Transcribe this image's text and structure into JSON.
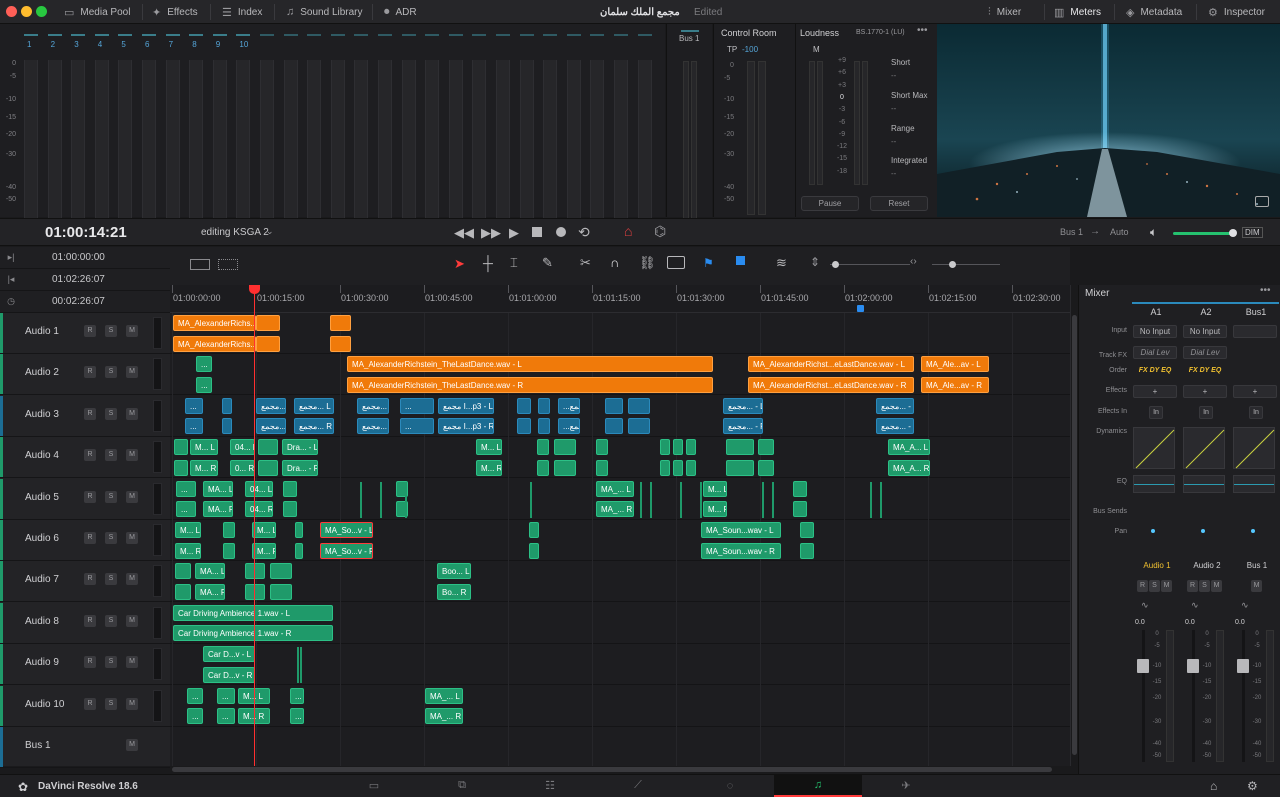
{
  "topbar": {
    "media_pool": "Media Pool",
    "effects": "Effects",
    "index": "Index",
    "sound_library": "Sound Library",
    "adr": "ADR",
    "project_title": "مجمع الملك سلمان",
    "project_status": "Edited",
    "mixer": "Mixer",
    "meters": "Meters",
    "metadata": "Metadata",
    "inspector": "Inspector"
  },
  "meters": {
    "channels": [
      "1",
      "2",
      "3",
      "4",
      "5",
      "6",
      "7",
      "8",
      "9",
      "10"
    ],
    "ticks": [
      "0",
      "-5",
      "-10",
      "-15",
      "-20",
      "-30",
      "-40",
      "-50"
    ]
  },
  "bus_meter": {
    "label": "Bus 1"
  },
  "control_room": {
    "title": "Control Room",
    "tp_label": "TP",
    "tp_value": "-100",
    "ticks": [
      "0",
      "-5",
      "-10",
      "-15",
      "-20",
      "-30",
      "-40",
      "-50"
    ]
  },
  "loudness": {
    "title": "Loudness",
    "standard": "BS.1770-1 (LU)",
    "m_label": "M",
    "ticks": [
      "+9",
      "+6",
      "+3",
      "0",
      "-3",
      "-6",
      "-9",
      "-12",
      "-15",
      "-18"
    ],
    "short_label": "Short",
    "short_value": "--",
    "short_max_label": "Short Max",
    "short_max_value": "--",
    "range_label": "Range",
    "range_value": "--",
    "integrated_label": "Integrated",
    "integrated_value": "--",
    "pause": "Pause",
    "reset": "Reset"
  },
  "transport": {
    "timecode": "01:00:14:21",
    "timeline_name": "editing KSGA 2",
    "bus": "Bus 1",
    "auto": "Auto",
    "dim": "DIM"
  },
  "timecodes": {
    "start": "01:00:00:00",
    "end": "01:02:26:07",
    "duration": "00:02:26:07"
  },
  "ruler": [
    "01:00:00:00",
    "01:00:15:00",
    "01:00:30:00",
    "01:00:45:00",
    "01:01:00:00",
    "01:01:15:00",
    "01:01:30:00",
    "01:01:45:00",
    "01:02:00:00",
    "01:02:15:00",
    "01:02:30:00"
  ],
  "tracks": [
    {
      "name": "Audio 1",
      "color": "#1f9a6a"
    },
    {
      "name": "Audio 2",
      "color": "#1f9a6a"
    },
    {
      "name": "Audio 3",
      "color": "#1c6d94"
    },
    {
      "name": "Audio 4",
      "color": "#1f9a6a"
    },
    {
      "name": "Audio 5",
      "color": "#1f9a6a"
    },
    {
      "name": "Audio 6",
      "color": "#1f9a6a"
    },
    {
      "name": "Audio 7",
      "color": "#1f9a6a"
    },
    {
      "name": "Audio 8",
      "color": "#1f9a6a"
    },
    {
      "name": "Audio 9",
      "color": "#1f9a6a"
    },
    {
      "name": "Audio 10",
      "color": "#1f9a6a"
    },
    {
      "name": "Bus 1",
      "color": "#1c6d94"
    }
  ],
  "track_buttons": {
    "r": "R",
    "s": "S",
    "m": "M"
  },
  "clips": {
    "a1_l": "MA_AlexanderRichs... LastDance.wav - L",
    "a1_r": "MA_AlexanderRichs... LastDance.wav - R",
    "a2_l": "MA_AlexanderRichstein_TheLastDance.wav - L",
    "a2_r": "MA_AlexanderRichstein_TheLastDance.wav - R",
    "a2b_l": "MA_AlexanderRichst...eLastDance.wav - L",
    "a2b_r": "MA_AlexanderRichst...eLastDance.wav - R",
    "a2c_l": "MA_Ale...av - L",
    "a2c_r": "MA_Ale...av - R",
    "a3_1": "مجمع... L",
    "a3_2": "مجمع... R",
    "a3_3": "مجمع... L",
    "a3_4": "مجمع... R",
    "a3_5": "مجمع... L",
    "a3_6": "مجمع... R",
    "a3_7": "مجمع I...p3 - L",
    "a3_8": "مجمع I...p3 - R",
    "a3_9": "...مجمع L",
    "a3_10": "...مجمع R",
    "a3_11": "مجمع... - L",
    "a3_12": "مجمع... - R",
    "a3_13": "مجمع... - L",
    "a3_14": "مجمع... - R",
    "dots": "...",
    "m_l": "M... L",
    "m_r": "M... R",
    "a4_04l": "04... L",
    "a4_0r": "0... R",
    "a4_dral": "Dra... - L",
    "a4_drar": "Dra... - R",
    "a4_mal": "M... L",
    "a4_mar": "M... R",
    "a4_ma2l": "MA_A... L",
    "a4_ma2r": "MA_A... R",
    "a5_mal": "MA... L",
    "a5_mar": "MA... R",
    "a5_04l": "04... L",
    "a5_04r": "04... R",
    "a5_ma_l": "MA_... L",
    "a5_ma_r": "MA_... R",
    "a5_m2l": "M... L",
    "a5_m2r": "M... R",
    "a6_so_l": "MA_So...v - L",
    "a6_so_r": "MA_So...v - R",
    "a6_soun_l": "MA_Soun...wav - L",
    "a6_soun_r": "MA_Soun...wav - R",
    "a7_mal": "MA... L",
    "a7_mar": "MA... R",
    "a7_bool": "Boo... L",
    "a7_boor": "Bo... R",
    "a8_l": "Car Driving Ambience 1.wav - L",
    "a8_r": "Car Driving Ambience 1.wav - R",
    "a9_l": "Car D...v - L",
    "a9_r": "Car D...v - R",
    "a10_l": "MA_... L",
    "a10_r": "MA_... R"
  },
  "mixer": {
    "title": "Mixer",
    "channels": [
      "A1",
      "A2",
      "Bus1"
    ],
    "input_label": "Input",
    "input_values": [
      "No Input",
      "No Input",
      ""
    ],
    "track_fx_label": "Track FX",
    "track_fx_values": [
      "Dial Lev",
      "Dial Lev"
    ],
    "order_label": "Order",
    "order_value": "FX DY EQ",
    "effects_label": "Effects",
    "effects_in_label": "Effects In",
    "effects_in_value": "In",
    "dynamics_label": "Dynamics",
    "eq_label": "EQ",
    "bus_sends_label": "Bus Sends",
    "pan_label": "Pan",
    "strip_names": [
      "Audio 1",
      "Audio 2",
      "Bus 1"
    ],
    "fader_value": "0.0",
    "fader_ticks": [
      "0",
      "-5",
      "-10",
      "-15",
      "-20",
      "-30",
      "-40",
      "-50"
    ]
  },
  "bottombar": {
    "app": "DaVinci Resolve 18.6"
  }
}
